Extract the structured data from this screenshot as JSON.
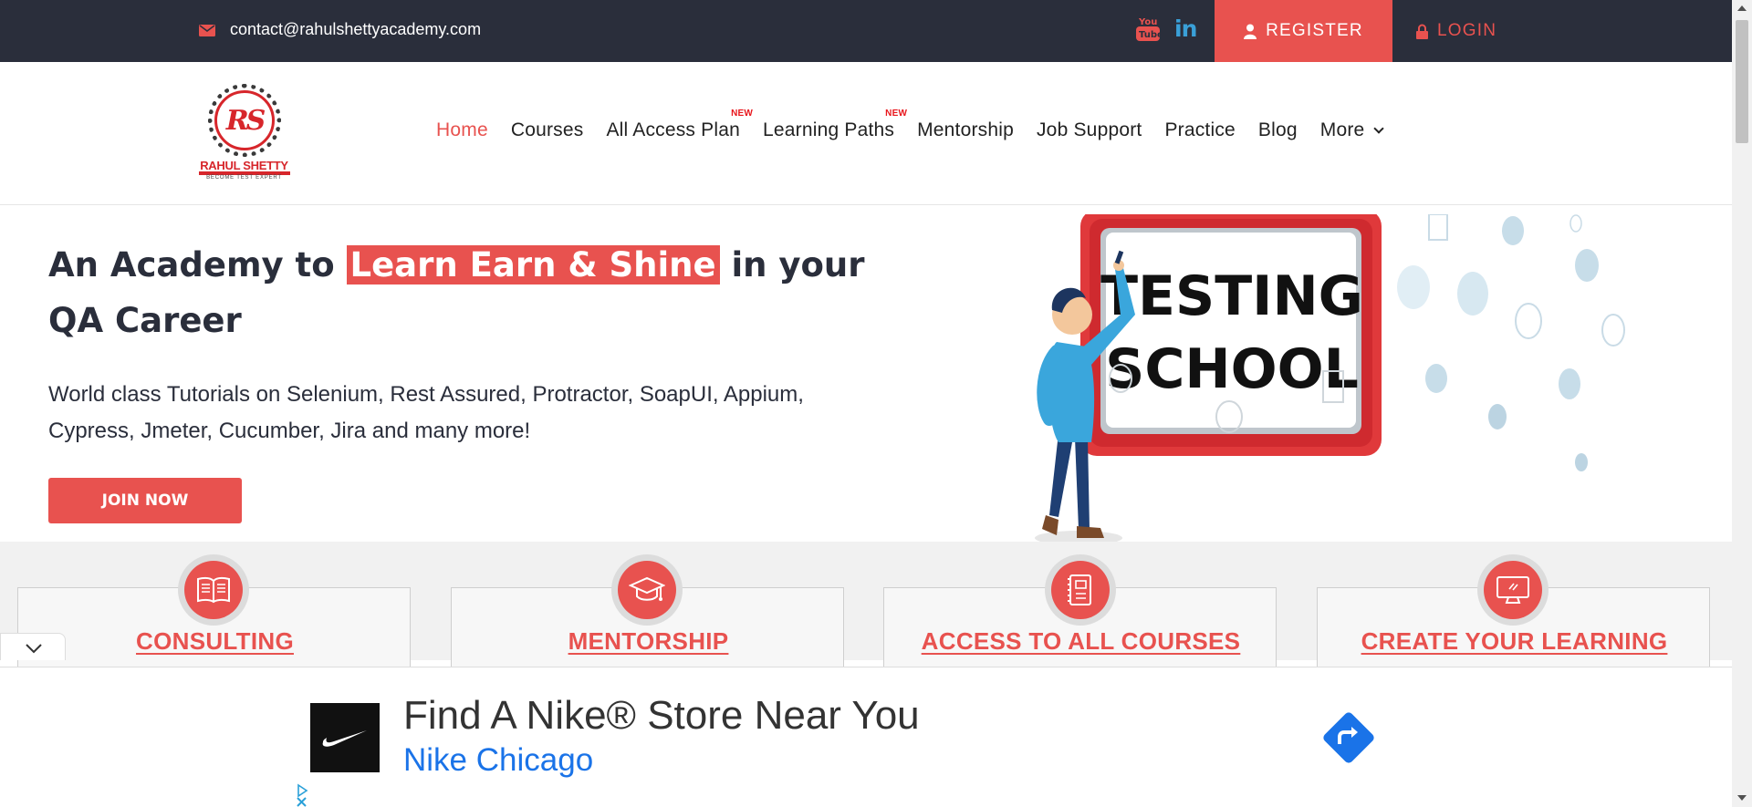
{
  "topbar": {
    "email": "contact@rahulshettyacademy.com",
    "icons": [
      "mail-icon",
      "youtube-icon",
      "linkedin-icon",
      "user-icon",
      "lock-icon"
    ],
    "youtube_text": "You Tube",
    "linkedin_text": "in",
    "register_label": "REGISTER",
    "login_label": "LOGIN"
  },
  "logo": {
    "monogram": "RS",
    "name": "RAHUL SHETTY",
    "tagline": "BECOME TEST EXPERT"
  },
  "nav": {
    "items": [
      {
        "label": "Home",
        "active": true,
        "badge": ""
      },
      {
        "label": "Courses",
        "badge": ""
      },
      {
        "label": "All Access Plan",
        "badge": "NEW"
      },
      {
        "label": "Learning Paths",
        "badge": "NEW"
      },
      {
        "label": "Mentorship",
        "badge": ""
      },
      {
        "label": "Job Support",
        "badge": ""
      },
      {
        "label": "Practice",
        "badge": ""
      },
      {
        "label": "Blog",
        "badge": ""
      },
      {
        "label": "More",
        "badge": ""
      }
    ]
  },
  "hero": {
    "title_pre": "An Academy to ",
    "title_highlight": "Learn Earn & Shine",
    "title_post": "  in your QA Career",
    "subtitle": "World class Tutorials on Selenium, Rest Assured, Protractor, SoapUI, Appium, Cypress, Jmeter, Cucumber, Jira and many more!",
    "cta_label": "JOIN NOW",
    "illustration_text_line1": "TESTING",
    "illustration_text_line2": "SCHOOL"
  },
  "features": [
    {
      "title": "CONSULTING",
      "icon": "book-icon"
    },
    {
      "title": "MENTORSHIP",
      "icon": "graduation-cap-icon"
    },
    {
      "title": "ACCESS TO ALL COURSES",
      "icon": "notebook-icon"
    },
    {
      "title": "CREATE YOUR LEARNING",
      "icon": "monitor-icon"
    }
  ],
  "ad": {
    "title": "Find A Nike® Store Near You",
    "subtitle": "Nike Chicago",
    "icons": [
      "nike-swoosh-icon",
      "directions-arrow-icon",
      "adchoices-icon",
      "close-icon",
      "chevron-down-icon"
    ]
  },
  "colors": {
    "accent": "#e8524f",
    "topbar_bg": "#2a2e3b",
    "text_dark": "#2a2e3b",
    "link_blue": "#1a73e8"
  }
}
